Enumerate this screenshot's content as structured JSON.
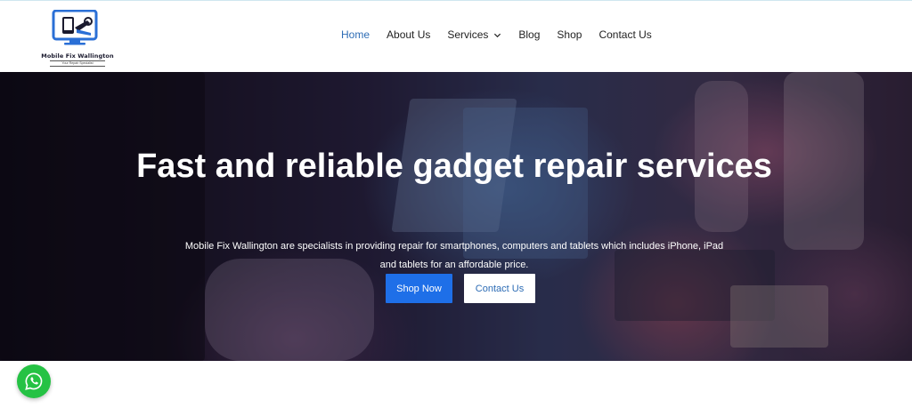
{
  "brand": {
    "name": "Mobile Fix Wallington",
    "tagline": "Your Repair Specialist"
  },
  "nav": {
    "items": [
      {
        "label": "Home",
        "active": true
      },
      {
        "label": "About Us",
        "active": false
      },
      {
        "label": "Services",
        "active": false,
        "has_dropdown": true
      },
      {
        "label": "Blog",
        "active": false
      },
      {
        "label": "Shop",
        "active": false
      },
      {
        "label": "Contact Us",
        "active": false
      }
    ]
  },
  "hero": {
    "title": "Fast and reliable gadget repair services",
    "subtitle": "Mobile Fix Wallington are specialists in providing repair for smartphones, computers and tablets which includes iPhone, iPad and tablets for an affordable price.",
    "primary_button": "Shop Now",
    "secondary_button": "Contact Us"
  },
  "icons": {
    "dropdown": "chevron-down-icon",
    "chat": "whatsapp-icon"
  },
  "colors": {
    "accent": "#1e6fe8",
    "nav_active": "#2d6cb5",
    "whatsapp": "#25c244"
  }
}
